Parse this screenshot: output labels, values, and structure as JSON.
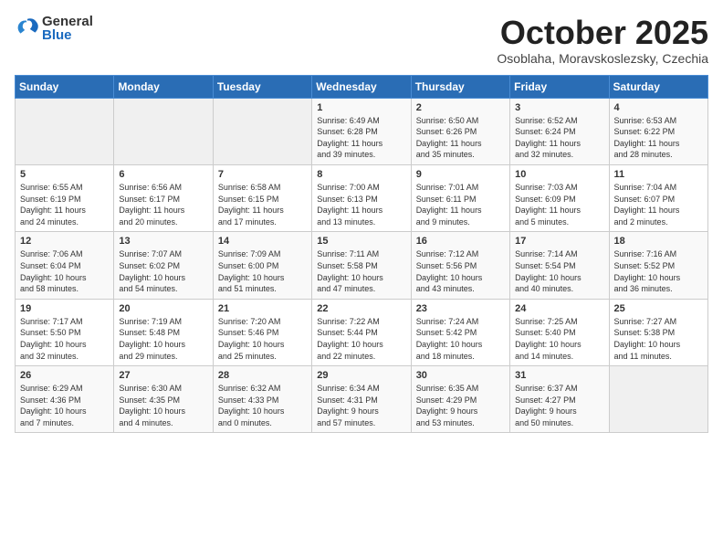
{
  "header": {
    "logo_general": "General",
    "logo_blue": "Blue",
    "month": "October 2025",
    "location": "Osoblaha, Moravskoslezsky, Czechia"
  },
  "weekdays": [
    "Sunday",
    "Monday",
    "Tuesday",
    "Wednesday",
    "Thursday",
    "Friday",
    "Saturday"
  ],
  "weeks": [
    [
      {
        "day": "",
        "info": ""
      },
      {
        "day": "",
        "info": ""
      },
      {
        "day": "",
        "info": ""
      },
      {
        "day": "1",
        "info": "Sunrise: 6:49 AM\nSunset: 6:28 PM\nDaylight: 11 hours\nand 39 minutes."
      },
      {
        "day": "2",
        "info": "Sunrise: 6:50 AM\nSunset: 6:26 PM\nDaylight: 11 hours\nand 35 minutes."
      },
      {
        "day": "3",
        "info": "Sunrise: 6:52 AM\nSunset: 6:24 PM\nDaylight: 11 hours\nand 32 minutes."
      },
      {
        "day": "4",
        "info": "Sunrise: 6:53 AM\nSunset: 6:22 PM\nDaylight: 11 hours\nand 28 minutes."
      }
    ],
    [
      {
        "day": "5",
        "info": "Sunrise: 6:55 AM\nSunset: 6:19 PM\nDaylight: 11 hours\nand 24 minutes."
      },
      {
        "day": "6",
        "info": "Sunrise: 6:56 AM\nSunset: 6:17 PM\nDaylight: 11 hours\nand 20 minutes."
      },
      {
        "day": "7",
        "info": "Sunrise: 6:58 AM\nSunset: 6:15 PM\nDaylight: 11 hours\nand 17 minutes."
      },
      {
        "day": "8",
        "info": "Sunrise: 7:00 AM\nSunset: 6:13 PM\nDaylight: 11 hours\nand 13 minutes."
      },
      {
        "day": "9",
        "info": "Sunrise: 7:01 AM\nSunset: 6:11 PM\nDaylight: 11 hours\nand 9 minutes."
      },
      {
        "day": "10",
        "info": "Sunrise: 7:03 AM\nSunset: 6:09 PM\nDaylight: 11 hours\nand 5 minutes."
      },
      {
        "day": "11",
        "info": "Sunrise: 7:04 AM\nSunset: 6:07 PM\nDaylight: 11 hours\nand 2 minutes."
      }
    ],
    [
      {
        "day": "12",
        "info": "Sunrise: 7:06 AM\nSunset: 6:04 PM\nDaylight: 10 hours\nand 58 minutes."
      },
      {
        "day": "13",
        "info": "Sunrise: 7:07 AM\nSunset: 6:02 PM\nDaylight: 10 hours\nand 54 minutes."
      },
      {
        "day": "14",
        "info": "Sunrise: 7:09 AM\nSunset: 6:00 PM\nDaylight: 10 hours\nand 51 minutes."
      },
      {
        "day": "15",
        "info": "Sunrise: 7:11 AM\nSunset: 5:58 PM\nDaylight: 10 hours\nand 47 minutes."
      },
      {
        "day": "16",
        "info": "Sunrise: 7:12 AM\nSunset: 5:56 PM\nDaylight: 10 hours\nand 43 minutes."
      },
      {
        "day": "17",
        "info": "Sunrise: 7:14 AM\nSunset: 5:54 PM\nDaylight: 10 hours\nand 40 minutes."
      },
      {
        "day": "18",
        "info": "Sunrise: 7:16 AM\nSunset: 5:52 PM\nDaylight: 10 hours\nand 36 minutes."
      }
    ],
    [
      {
        "day": "19",
        "info": "Sunrise: 7:17 AM\nSunset: 5:50 PM\nDaylight: 10 hours\nand 32 minutes."
      },
      {
        "day": "20",
        "info": "Sunrise: 7:19 AM\nSunset: 5:48 PM\nDaylight: 10 hours\nand 29 minutes."
      },
      {
        "day": "21",
        "info": "Sunrise: 7:20 AM\nSunset: 5:46 PM\nDaylight: 10 hours\nand 25 minutes."
      },
      {
        "day": "22",
        "info": "Sunrise: 7:22 AM\nSunset: 5:44 PM\nDaylight: 10 hours\nand 22 minutes."
      },
      {
        "day": "23",
        "info": "Sunrise: 7:24 AM\nSunset: 5:42 PM\nDaylight: 10 hours\nand 18 minutes."
      },
      {
        "day": "24",
        "info": "Sunrise: 7:25 AM\nSunset: 5:40 PM\nDaylight: 10 hours\nand 14 minutes."
      },
      {
        "day": "25",
        "info": "Sunrise: 7:27 AM\nSunset: 5:38 PM\nDaylight: 10 hours\nand 11 minutes."
      }
    ],
    [
      {
        "day": "26",
        "info": "Sunrise: 6:29 AM\nSunset: 4:36 PM\nDaylight: 10 hours\nand 7 minutes."
      },
      {
        "day": "27",
        "info": "Sunrise: 6:30 AM\nSunset: 4:35 PM\nDaylight: 10 hours\nand 4 minutes."
      },
      {
        "day": "28",
        "info": "Sunrise: 6:32 AM\nSunset: 4:33 PM\nDaylight: 10 hours\nand 0 minutes."
      },
      {
        "day": "29",
        "info": "Sunrise: 6:34 AM\nSunset: 4:31 PM\nDaylight: 9 hours\nand 57 minutes."
      },
      {
        "day": "30",
        "info": "Sunrise: 6:35 AM\nSunset: 4:29 PM\nDaylight: 9 hours\nand 53 minutes."
      },
      {
        "day": "31",
        "info": "Sunrise: 6:37 AM\nSunset: 4:27 PM\nDaylight: 9 hours\nand 50 minutes."
      },
      {
        "day": "",
        "info": ""
      }
    ]
  ]
}
